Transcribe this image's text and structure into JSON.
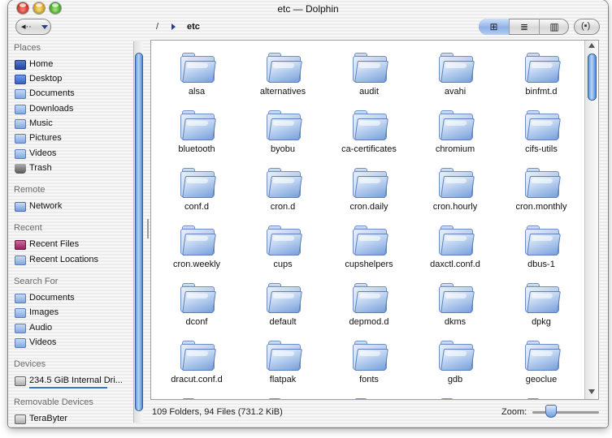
{
  "window": {
    "title": "etc — Dolphin"
  },
  "toolbar": {
    "back_glyph": "◂··",
    "breadcrumb_root": "/",
    "breadcrumb_current": "etc",
    "view_modes": [
      {
        "name": "icons",
        "glyph": "⊞",
        "active": true
      },
      {
        "name": "details",
        "glyph": "≣",
        "active": false
      },
      {
        "name": "columns",
        "glyph": "▥",
        "active": false
      }
    ],
    "menu_glyph": "(▪)"
  },
  "sidebar": {
    "sections": [
      {
        "title": "Places",
        "items": [
          {
            "label": "Home",
            "icon": "home-icon"
          },
          {
            "label": "Desktop",
            "icon": "desktop-icon"
          },
          {
            "label": "Documents",
            "icon": "folder-icon"
          },
          {
            "label": "Downloads",
            "icon": "folder-icon"
          },
          {
            "label": "Music",
            "icon": "folder-icon"
          },
          {
            "label": "Pictures",
            "icon": "folder-icon"
          },
          {
            "label": "Videos",
            "icon": "folder-icon"
          },
          {
            "label": "Trash",
            "icon": "trash-icon"
          }
        ]
      },
      {
        "title": "Remote",
        "items": [
          {
            "label": "Network",
            "icon": "network-icon"
          }
        ]
      },
      {
        "title": "Recent",
        "items": [
          {
            "label": "Recent Files",
            "icon": "recent-files-icon"
          },
          {
            "label": "Recent Locations",
            "icon": "folder-icon"
          }
        ]
      },
      {
        "title": "Search For",
        "items": [
          {
            "label": "Documents",
            "icon": "folder-icon"
          },
          {
            "label": "Images",
            "icon": "folder-icon"
          },
          {
            "label": "Audio",
            "icon": "folder-icon"
          },
          {
            "label": "Videos",
            "icon": "folder-icon"
          }
        ]
      },
      {
        "title": "Devices",
        "items": [
          {
            "label": "234.5 GiB Internal Dri...",
            "icon": "drive-icon"
          }
        ]
      },
      {
        "title": "Removable Devices",
        "items": [
          {
            "label": "TeraByter",
            "icon": "drive-icon"
          }
        ]
      }
    ]
  },
  "files": [
    "alsa",
    "alternatives",
    "audit",
    "avahi",
    "binfmt.d",
    "bluetooth",
    "byobu",
    "ca-certificates",
    "chromium",
    "cifs-utils",
    "conf.d",
    "cron.d",
    "cron.daily",
    "cron.hourly",
    "cron.monthly",
    "cron.weekly",
    "cups",
    "cupshelpers",
    "daxctl.conf.d",
    "dbus-1",
    "dconf",
    "default",
    "depmod.d",
    "dkms",
    "dpkg",
    "dracut.conf.d",
    "flatpak",
    "fonts",
    "gdb",
    "geoclue"
  ],
  "status": {
    "summary": "109 Folders, 94 Files (731.2 KiB)",
    "zoom_label": "Zoom:"
  },
  "colors": {
    "accent": "#3a72d0",
    "folder_blue": "#7aa3dc"
  }
}
